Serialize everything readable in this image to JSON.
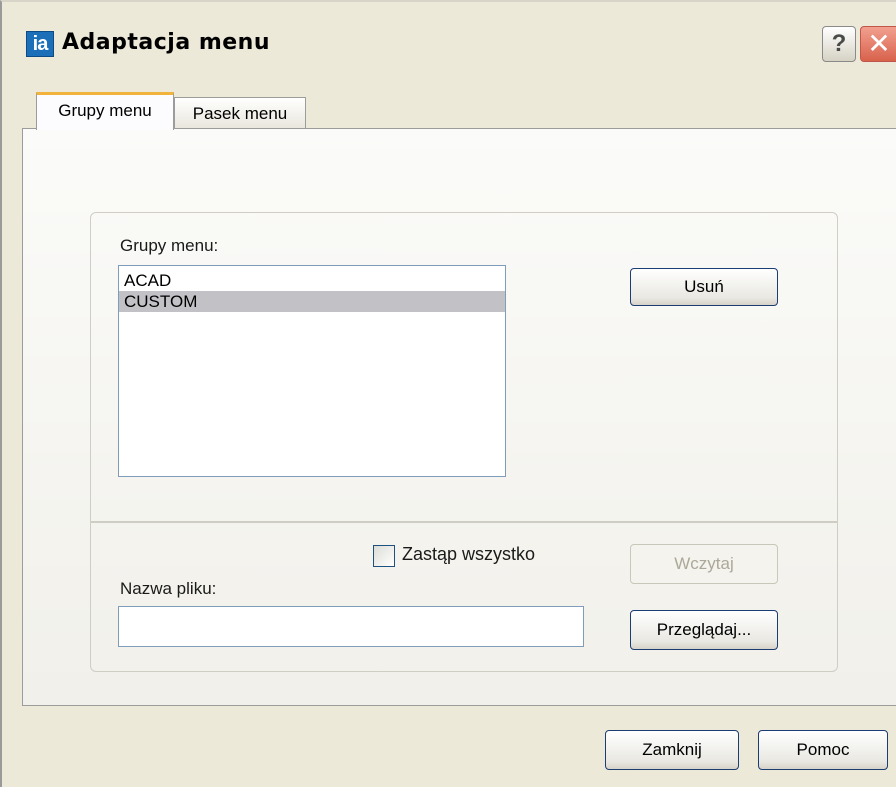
{
  "window": {
    "title": "Adaptacja menu",
    "app_icon_text": "ia",
    "help_label": "?",
    "close_label": "✕"
  },
  "tabs": [
    {
      "label": "Grupy menu",
      "active": true
    },
    {
      "label": "Pasek menu",
      "active": false
    }
  ],
  "menu_groups": {
    "label": "Grupy menu:",
    "items": [
      {
        "label": "ACAD",
        "selected": false
      },
      {
        "label": "CUSTOM",
        "selected": true
      }
    ],
    "remove_button": "Usuń"
  },
  "load_section": {
    "replace_all_label": "Zastąp wszystko",
    "replace_all_checked": false,
    "load_button": "Wczytaj",
    "load_button_enabled": false,
    "filename_label": "Nazwa pliku:",
    "filename_value": "",
    "browse_button": "Przeglądaj..."
  },
  "footer": {
    "close_button": "Zamknij",
    "help_button": "Pomoc"
  },
  "colors": {
    "dialog_bg": "#ece9d8",
    "active_tab_accent": "#f2b33d",
    "selection_bg": "#c2c2c6",
    "input_border": "#7f9db9",
    "button_border": "#1c3c74"
  }
}
